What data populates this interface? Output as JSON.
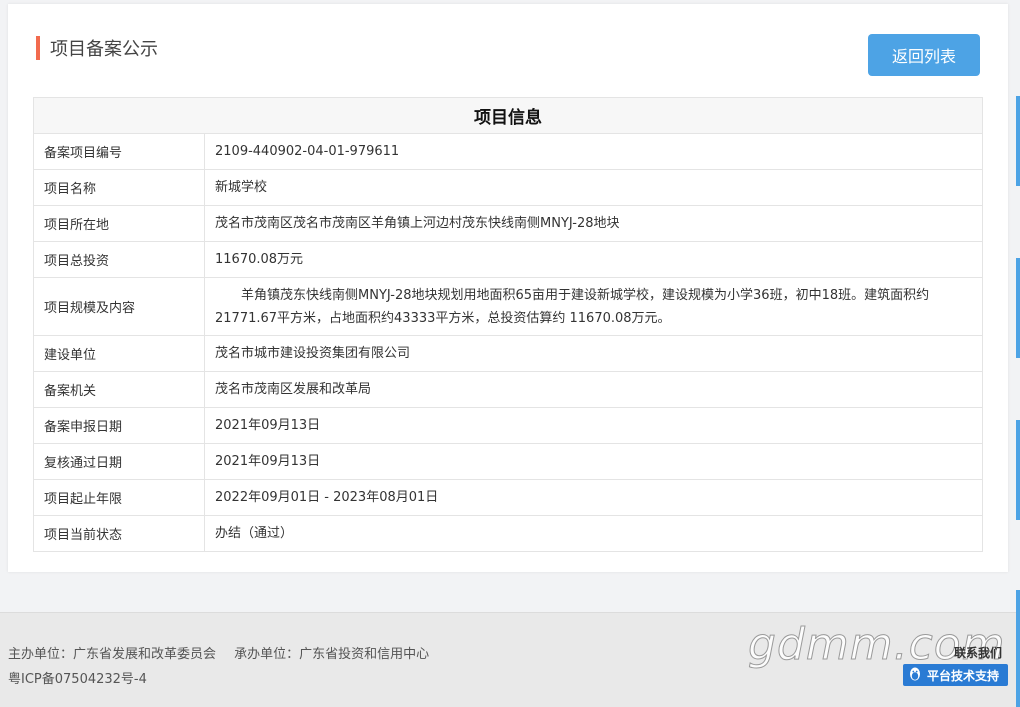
{
  "header": {
    "title": "项目备案公示",
    "back_button": "返回列表"
  },
  "table": {
    "heading": "项目信息",
    "rows": [
      {
        "label": "备案项目编号",
        "value": "2109-440902-04-01-979611"
      },
      {
        "label": "项目名称",
        "value": "新城学校"
      },
      {
        "label": "项目所在地",
        "value": "茂名市茂南区茂名市茂南区羊角镇上河边村茂东快线南侧MNYJ-28地块"
      },
      {
        "label": "项目总投资",
        "value": "11670.08万元"
      },
      {
        "label": "项目规模及内容",
        "value": "羊角镇茂东快线南侧MNYJ-28地块规划用地面积65亩用于建设新城学校，建设规模为小学36班，初中18班。建筑面积约21771.67平方米，占地面积约43333平方米，总投资估算约 11670.08万元。"
      },
      {
        "label": "建设单位",
        "value": "茂名市城市建设投资集团有限公司"
      },
      {
        "label": "备案机关",
        "value": "茂名市茂南区发展和改革局"
      },
      {
        "label": "备案申报日期",
        "value": "2021年09月13日"
      },
      {
        "label": "复核通过日期",
        "value": "2021年09月13日"
      },
      {
        "label": "项目起止年限",
        "value": "2022年09月01日 - 2023年08月01日"
      },
      {
        "label": "项目当前状态",
        "value": "办结（通过）"
      }
    ]
  },
  "footer": {
    "sponsor": "主办单位：广东省发展和改革委员会",
    "organizer": "承办单位：广东省投资和信用中心",
    "icp": "粤ICP备07504232号-4",
    "contact": "联系我们",
    "support": "平台技术支持",
    "watermark": "gdmm.com"
  },
  "colors": {
    "accent": "#f26b4e",
    "button": "#4da3e5",
    "support": "#2a7bd4"
  },
  "icons": {
    "support": "qq-penguin-icon"
  }
}
